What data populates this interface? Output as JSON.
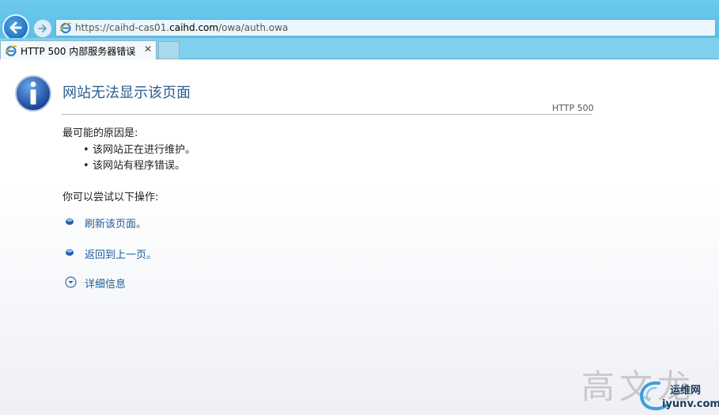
{
  "browser": {
    "url_prefix": "https://caihd-cas01.",
    "url_host": "caihd.com",
    "url_path": "/owa/auth.owa",
    "tab_title": "HTTP 500 内部服务器错误",
    "tab_close": "✕"
  },
  "page": {
    "title": "网站无法显示该页面",
    "code": "HTTP 500",
    "reasons_heading": "最可能的原因是:",
    "reasons": [
      "该网站正在进行维护。",
      "该网站有程序错误。"
    ],
    "try_heading": "你可以尝试以下操作:",
    "actions": {
      "refresh": "刷新该页面。",
      "back": "返回到上一页。",
      "details": "详细信息"
    }
  },
  "watermark": {
    "text": "高文龙",
    "site_cn": "运维网",
    "site_en": "iyunv.com"
  },
  "colors": {
    "chrome": "#7fd0ee",
    "link": "#1e5a96",
    "title": "#2a5c8a"
  },
  "icons": {
    "back": "back-arrow-icon",
    "forward": "forward-arrow-icon",
    "ie": "ie-logo-icon",
    "info": "info-icon",
    "bullet": "blue-bullet-icon",
    "expand": "chevron-down-circle-icon"
  }
}
